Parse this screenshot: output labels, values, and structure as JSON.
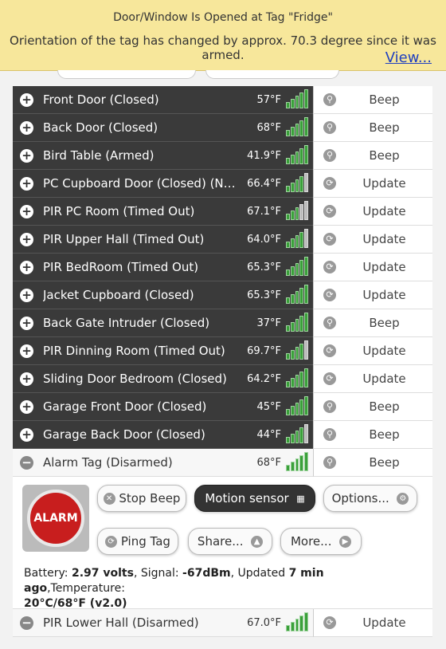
{
  "banner": {
    "title": "Door/Window Is Opened at Tag \"Fridge\"",
    "message": "Orientation of the tag has changed by approx. 70.3 degree since it was armed.",
    "link": "View..."
  },
  "tags": [
    {
      "name": "Front Door (Closed)",
      "temp": "57°F",
      "signal": 5,
      "action": "Beep",
      "action_icon": "search-icon"
    },
    {
      "name": "Back Door (Closed)",
      "temp": "68°F",
      "signal": 5,
      "action": "Beep",
      "action_icon": "search-icon"
    },
    {
      "name": "Bird Table (Armed)",
      "temp": "41.9°F",
      "signal": 5,
      "action": "Beep",
      "action_icon": "search-icon"
    },
    {
      "name": "PC Cupboard Door (Closed) (Normal ...",
      "temp": "66.4°F",
      "signal": 4,
      "action": "Update",
      "action_icon": "refresh-icon"
    },
    {
      "name": "PIR PC Room (Timed Out)",
      "temp": "67.1°F",
      "signal": 3,
      "action": "Update",
      "action_icon": "refresh-icon"
    },
    {
      "name": "PIR Upper Hall (Timed Out)",
      "temp": "64.0°F",
      "signal": 4,
      "action": "Update",
      "action_icon": "refresh-icon"
    },
    {
      "name": "PIR BedRoom (Timed Out)",
      "temp": "65.3°F",
      "signal": 5,
      "action": "Update",
      "action_icon": "refresh-icon"
    },
    {
      "name": "Jacket Cupboard (Closed)",
      "temp": "65.3°F",
      "signal": 5,
      "action": "Update",
      "action_icon": "refresh-icon"
    },
    {
      "name": "Back Gate Intruder (Closed)",
      "temp": "37°F",
      "signal": 5,
      "action": "Beep",
      "action_icon": "search-icon"
    },
    {
      "name": "PIR Dinning Room (Timed Out)",
      "temp": "69.7°F",
      "signal": 4,
      "action": "Update",
      "action_icon": "refresh-icon"
    },
    {
      "name": "Sliding Door Bedroom (Closed)",
      "temp": "64.2°F",
      "signal": 5,
      "action": "Update",
      "action_icon": "refresh-icon"
    },
    {
      "name": "Garage Front Door (Closed)",
      "temp": "45°F",
      "signal": 5,
      "action": "Beep",
      "action_icon": "search-icon"
    },
    {
      "name": "Garage Back Door (Closed)",
      "temp": "44°F",
      "signal": 4,
      "action": "Beep",
      "action_icon": "search-icon"
    }
  ],
  "expanded": {
    "name": "Alarm Tag (Disarmed)",
    "temp": "68°F",
    "signal": 5,
    "action": "Beep",
    "image_label": "ALARM",
    "buttons": {
      "stop_beep": "Stop Beep",
      "motion_sensor": "Motion sensor",
      "options": "Options...",
      "ping_tag": "Ping Tag",
      "share": "Share...",
      "more": "More..."
    },
    "info": {
      "battery_label": "Battery: ",
      "battery": "2.97 volts",
      "signal_label": ", Signal: ",
      "signal": "-67dBm",
      "updated_label": ", Updated ",
      "updated": "7 min ago",
      "temp_label": ",Temperature: ",
      "temp": "20°C/68°F (v2.0)"
    }
  },
  "after": [
    {
      "name": "PIR Lower Hall (Disarmed)",
      "temp": "67.0°F",
      "signal": 5,
      "action": "Update",
      "action_icon": "refresh-icon"
    }
  ],
  "colors": {
    "banner_bg": "#f7e79b",
    "row_dark": "#3a3a3a",
    "signal_green": "#3aa03a",
    "link": "#1f3fbf"
  }
}
